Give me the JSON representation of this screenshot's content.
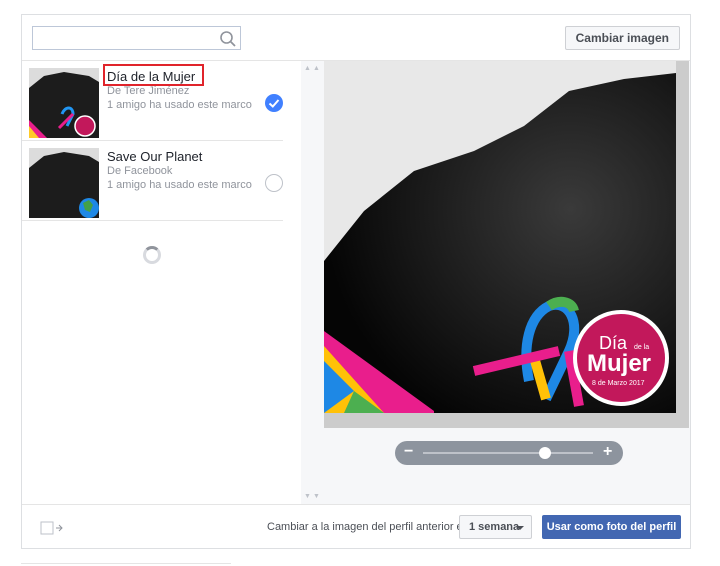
{
  "header": {
    "search_placeholder": "",
    "change_image_label": "Cambiar imagen"
  },
  "frames": [
    {
      "title": "Día de la Mujer",
      "author": "De Tere Jiménez",
      "usage": "1 amigo ha usado este marco",
      "selected": true
    },
    {
      "title": "Save Our Planet",
      "author": "De Facebook",
      "usage": "1 amigo ha usado este marco",
      "selected": false
    }
  ],
  "preview": {
    "badge_line1": "Día",
    "badge_small": "de la",
    "badge_line2": "Mujer",
    "badge_date": "8 de Marzo 2017"
  },
  "zoom": {
    "minus_label": "−",
    "plus_label": "+",
    "level": 0.72
  },
  "footer": {
    "revert_label": "Cambiar a la imagen del perfil anterior en",
    "duration_value": "1 semana",
    "primary_label": "Usar como foto del perfil"
  },
  "colors": {
    "accent": "#4267b2",
    "check": "#4080ff",
    "highlight_box": "#e0242b",
    "badge": "#c2185b"
  }
}
